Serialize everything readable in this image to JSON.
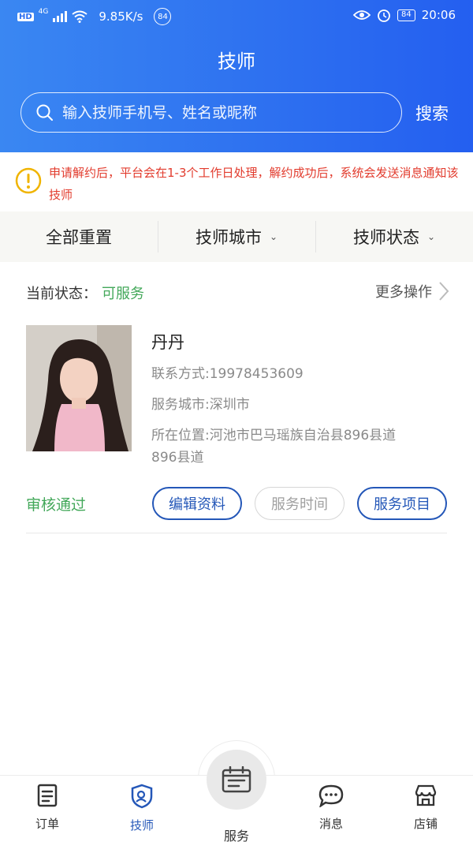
{
  "status_bar": {
    "hd": "HD",
    "network": "4G",
    "speed": "9.85K/s",
    "badge": "84",
    "battery": "84",
    "time": "20:06"
  },
  "header": {
    "title": "技师",
    "search_placeholder": "输入技师手机号、姓名或昵称",
    "search_button": "搜索"
  },
  "notice": {
    "text": "申请解约后，平台会在1-3个工作日处理，解约成功后，系统会发送消息通知该技师"
  },
  "filters": {
    "reset": "全部重置",
    "city": "技师城市",
    "status": "技师状态"
  },
  "card": {
    "status_label": "当前状态：",
    "status_value": "可服务",
    "more_ops": "更多操作",
    "name": "丹丹",
    "contact": "联系方式:19978453609",
    "city": "服务城市:深圳市",
    "location_line1": "所在位置:河池市巴马瑶族自治县896县道",
    "location_line2": "896县道",
    "audit": "审核通过",
    "btn_edit": "编辑资料",
    "btn_time": "服务时间",
    "btn_items": "服务项目"
  },
  "tabbar": {
    "orders": "订单",
    "technician": "技师",
    "service": "服务",
    "messages": "消息",
    "store": "店铺"
  },
  "colors": {
    "primary": "#2d6ff0",
    "accent_blue": "#2457b8",
    "green": "#43a85a",
    "warning_red": "#e23b2d",
    "warning_yellow": "#f0b400"
  }
}
